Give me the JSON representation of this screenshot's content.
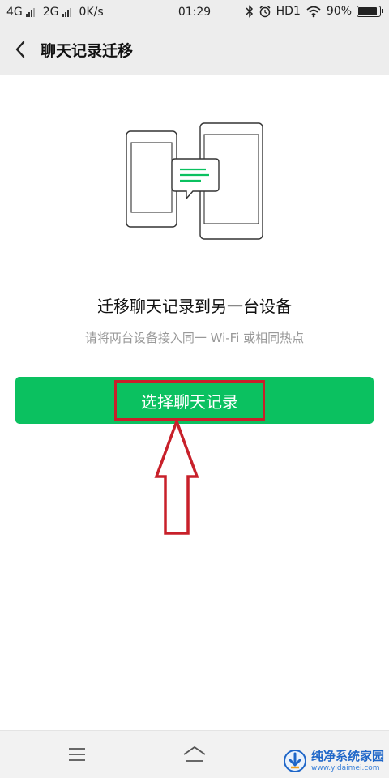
{
  "status_bar": {
    "network_1": "4G",
    "network_2": "2G",
    "speed": "0K/s",
    "time": "01:29",
    "hd": "HD1",
    "battery_text": "90%",
    "battery_level": 0.9
  },
  "header": {
    "title": "聊天记录迁移"
  },
  "main": {
    "headline": "迁移聊天记录到另一台设备",
    "subtext": "请将两台设备接入同一 Wi-Fi 或相同热点",
    "button_label": "选择聊天记录"
  },
  "colors": {
    "accent": "#0bc160",
    "annotation": "#c8202a"
  },
  "icons": [
    "back-arrow-icon",
    "bluetooth-icon",
    "alarm-icon",
    "wifi-icon",
    "battery-icon",
    "menu-icon",
    "home-icon"
  ],
  "watermark": {
    "title": "纯净系统家园",
    "url": "www.yidaimei.com"
  }
}
